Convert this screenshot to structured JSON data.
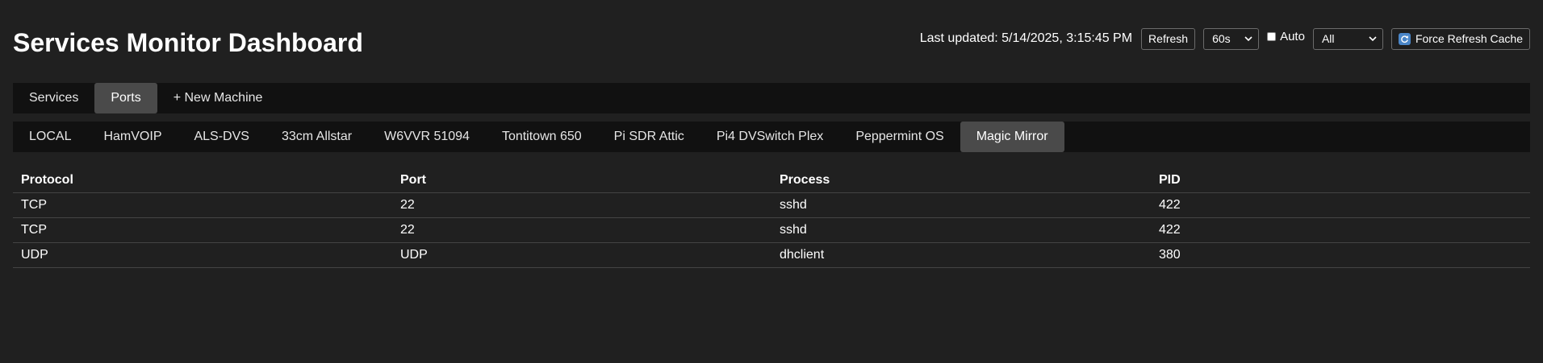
{
  "page_title": "Services Monitor Dashboard",
  "controls": {
    "last_updated": "Last updated: 5/14/2025, 3:15:45 PM",
    "refresh_label": "Refresh",
    "interval_value": "60s",
    "auto_label": "Auto",
    "auto_checked": false,
    "filter_value": "All",
    "force_refresh_label": "Force Refresh Cache"
  },
  "main_tabs": [
    {
      "label": "Services",
      "active": false
    },
    {
      "label": "Ports",
      "active": true
    },
    {
      "label": "+ New Machine",
      "active": false
    }
  ],
  "machine_tabs": [
    {
      "label": "LOCAL",
      "active": false
    },
    {
      "label": "HamVOIP",
      "active": false
    },
    {
      "label": "ALS-DVS",
      "active": false
    },
    {
      "label": "33cm Allstar",
      "active": false
    },
    {
      "label": "W6VVR 51094",
      "active": false
    },
    {
      "label": "Tontitown 650",
      "active": false
    },
    {
      "label": "Pi SDR Attic",
      "active": false
    },
    {
      "label": "Pi4 DVSwitch Plex",
      "active": false
    },
    {
      "label": "Peppermint OS",
      "active": false
    },
    {
      "label": "Magic Mirror",
      "active": true
    }
  ],
  "ports_table": {
    "columns": [
      "Protocol",
      "Port",
      "Process",
      "PID"
    ],
    "rows": [
      [
        "TCP",
        "22",
        "sshd",
        "422"
      ],
      [
        "TCP",
        "22",
        "sshd",
        "422"
      ],
      [
        "UDP",
        "UDP",
        "dhclient",
        "380"
      ]
    ]
  },
  "icons": {
    "force_refresh": "refresh-icon",
    "select_arrow": "chevron-down-icon"
  },
  "colors": {
    "background": "#202020",
    "tab_bar": "#111111",
    "active_tab": "#4a4a4a",
    "refresh_icon": "#4a86c8"
  }
}
